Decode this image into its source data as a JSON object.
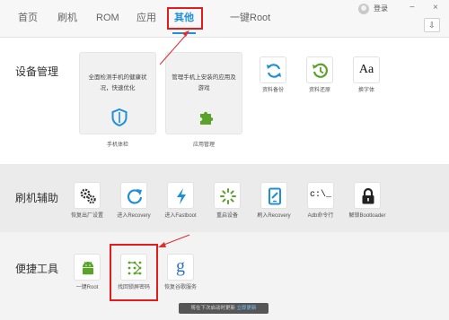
{
  "nav": {
    "tabs": [
      {
        "label": "首页"
      },
      {
        "label": "刷机"
      },
      {
        "label": "ROM"
      },
      {
        "label": "应用"
      },
      {
        "label": "其他"
      },
      {
        "label": "一键Root"
      }
    ],
    "active_tab": "其他",
    "login_label": "登录",
    "minimize_glyph": "−",
    "close_glyph": "×",
    "download_glyph": "⇩"
  },
  "sections": {
    "device": {
      "title": "设备管理",
      "cards": [
        {
          "text": "全面检测手机的健康状况，快速优化",
          "caption": "手机体检",
          "icon": "shield-icon"
        },
        {
          "text": "管理手机上安装的应用及游戏",
          "caption": "应用管理",
          "icon": "puzzle-icon"
        }
      ],
      "tools": [
        {
          "label": "资料备份",
          "icon": "sync-icon"
        },
        {
          "label": "资料还原",
          "icon": "restore-clock-icon"
        },
        {
          "label": "换字体",
          "icon": "font-icon",
          "glyph": "Aa"
        }
      ]
    },
    "flash": {
      "title": "刷机辅助",
      "tools": [
        {
          "label": "恢复出厂设置",
          "icon": "gears-icon"
        },
        {
          "label": "进入Recovery",
          "icon": "refresh-arrow-icon"
        },
        {
          "label": "进入Fastboot",
          "icon": "lightning-icon"
        },
        {
          "label": "重启设备",
          "icon": "loading-spinner-icon"
        },
        {
          "label": "刷入Recovery",
          "icon": "phone-edit-icon"
        },
        {
          "label": "Adb命令行",
          "icon": "terminal-icon",
          "glyph": "c:\\_"
        },
        {
          "label": "解锁Bootloader",
          "icon": "padlock-icon"
        }
      ]
    },
    "quick": {
      "title": "便捷工具",
      "tools": [
        {
          "label": "一键Root",
          "icon": "android-icon"
        },
        {
          "label": "找回锁屏密码",
          "icon": "pattern-lock-icon"
        },
        {
          "label": "恢复谷歌服务",
          "icon": "google-icon",
          "glyph": "g"
        }
      ]
    }
  },
  "bottom_bar": {
    "text": "将在下次启动时更新",
    "link": "立即更新"
  },
  "colors": {
    "accent": "#1e8fd8",
    "highlight": "#e21b1b",
    "icon_blue": "#1e8fd8",
    "icon_green": "#5aa22a"
  }
}
